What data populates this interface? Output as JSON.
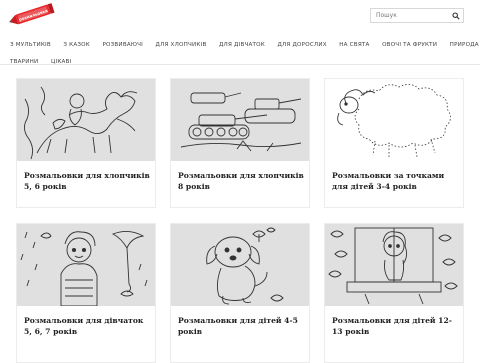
{
  "site": {
    "logo_alt": "розмальовки",
    "brand_color": "#e8272b"
  },
  "search": {
    "placeholder": "Пошук",
    "icon": "search-icon"
  },
  "nav": {
    "row1": [
      "З мультиків",
      "З казок",
      "Розвиваючі",
      "Для хлопчиків",
      "Для дівчаток",
      "Для дорослих",
      "На свята",
      "Овочі та фрукти",
      "Природа"
    ],
    "row2": [
      "Тварини",
      "Цікаві"
    ]
  },
  "cards": [
    {
      "title": "Розмальовки для хлопчиків 5, 6 років",
      "image": "boy-on-horse-drawing"
    },
    {
      "title": "Розмальовки для хлопчиків 8 років",
      "image": "tanks-drawing"
    },
    {
      "title": "Розмальовки за точками для дітей 3-4 років",
      "image": "sheep-dots-drawing"
    },
    {
      "title": "Розмальовки для дівчаток 5, 6, 7 років",
      "image": "girl-umbrella-drawing"
    },
    {
      "title": "Розмальовки для дітей 4-5 років",
      "image": "puppy-drawing"
    },
    {
      "title": "Розмальовки для дітей 12-13 років",
      "image": "girl-window-drawing"
    }
  ]
}
